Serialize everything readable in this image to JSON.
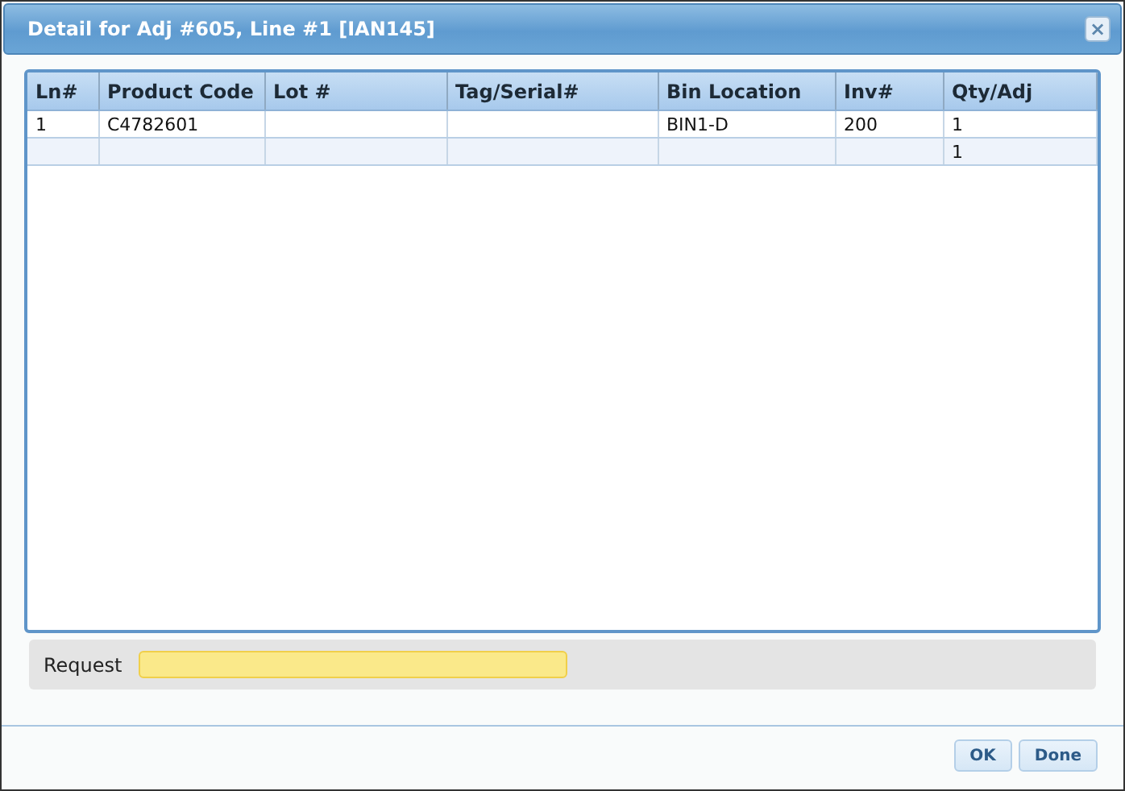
{
  "window": {
    "title": "Detail for Adj #605, Line #1 [IAN145]",
    "close": "×"
  },
  "table": {
    "columns": [
      "Ln#",
      "Product Code",
      "Lot #",
      "Tag/Serial#",
      "Bin Location",
      "Inv#",
      "Qty/Adj"
    ],
    "rows": [
      [
        "1",
        "C4782601",
        "",
        "",
        "BIN1-D",
        "200",
        "1"
      ],
      [
        "",
        "",
        "",
        "",
        "",
        "",
        "1"
      ]
    ]
  },
  "request": {
    "label": "Request"
  },
  "buttons": [
    "OK",
    "Done"
  ]
}
